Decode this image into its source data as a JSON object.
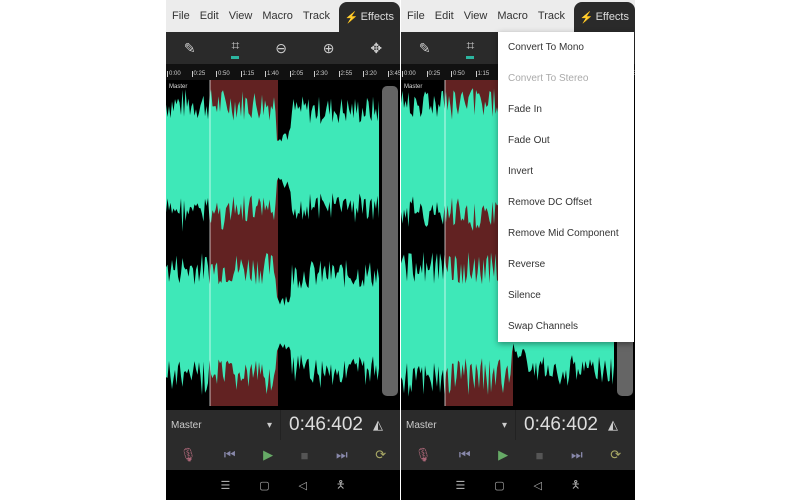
{
  "menubar": {
    "items": [
      "File",
      "Edit",
      "View",
      "Macro",
      "Track"
    ],
    "effects": "Effects"
  },
  "toolbar": {
    "icons": [
      "pencil-icon",
      "crop-icon",
      "zoom-out-icon",
      "zoom-in-icon",
      "move-icon"
    ]
  },
  "ruler": {
    "labels": [
      "0:00",
      "0:25",
      "0:50",
      "1:15",
      "1:40",
      "2:05",
      "2:30",
      "2:55",
      "3:20",
      "3:45"
    ]
  },
  "track": {
    "label": "Master",
    "selector": "Master",
    "time": "0:46:402"
  },
  "colors": {
    "wave": "#3ee8b8",
    "selection": "#7a2a2a",
    "accent": "#2cb5a0"
  },
  "effects_menu": {
    "items": [
      {
        "label": "Convert To Mono",
        "enabled": true
      },
      {
        "label": "Convert To Stereo",
        "enabled": false
      },
      {
        "label": "Fade In",
        "enabled": true
      },
      {
        "label": "Fade Out",
        "enabled": true
      },
      {
        "label": "Invert",
        "enabled": true
      },
      {
        "label": "Remove DC Offset",
        "enabled": true
      },
      {
        "label": "Remove Mid Component",
        "enabled": true
      },
      {
        "label": "Reverse",
        "enabled": true
      },
      {
        "label": "Silence",
        "enabled": true
      },
      {
        "label": "Swap Channels",
        "enabled": true
      }
    ]
  }
}
